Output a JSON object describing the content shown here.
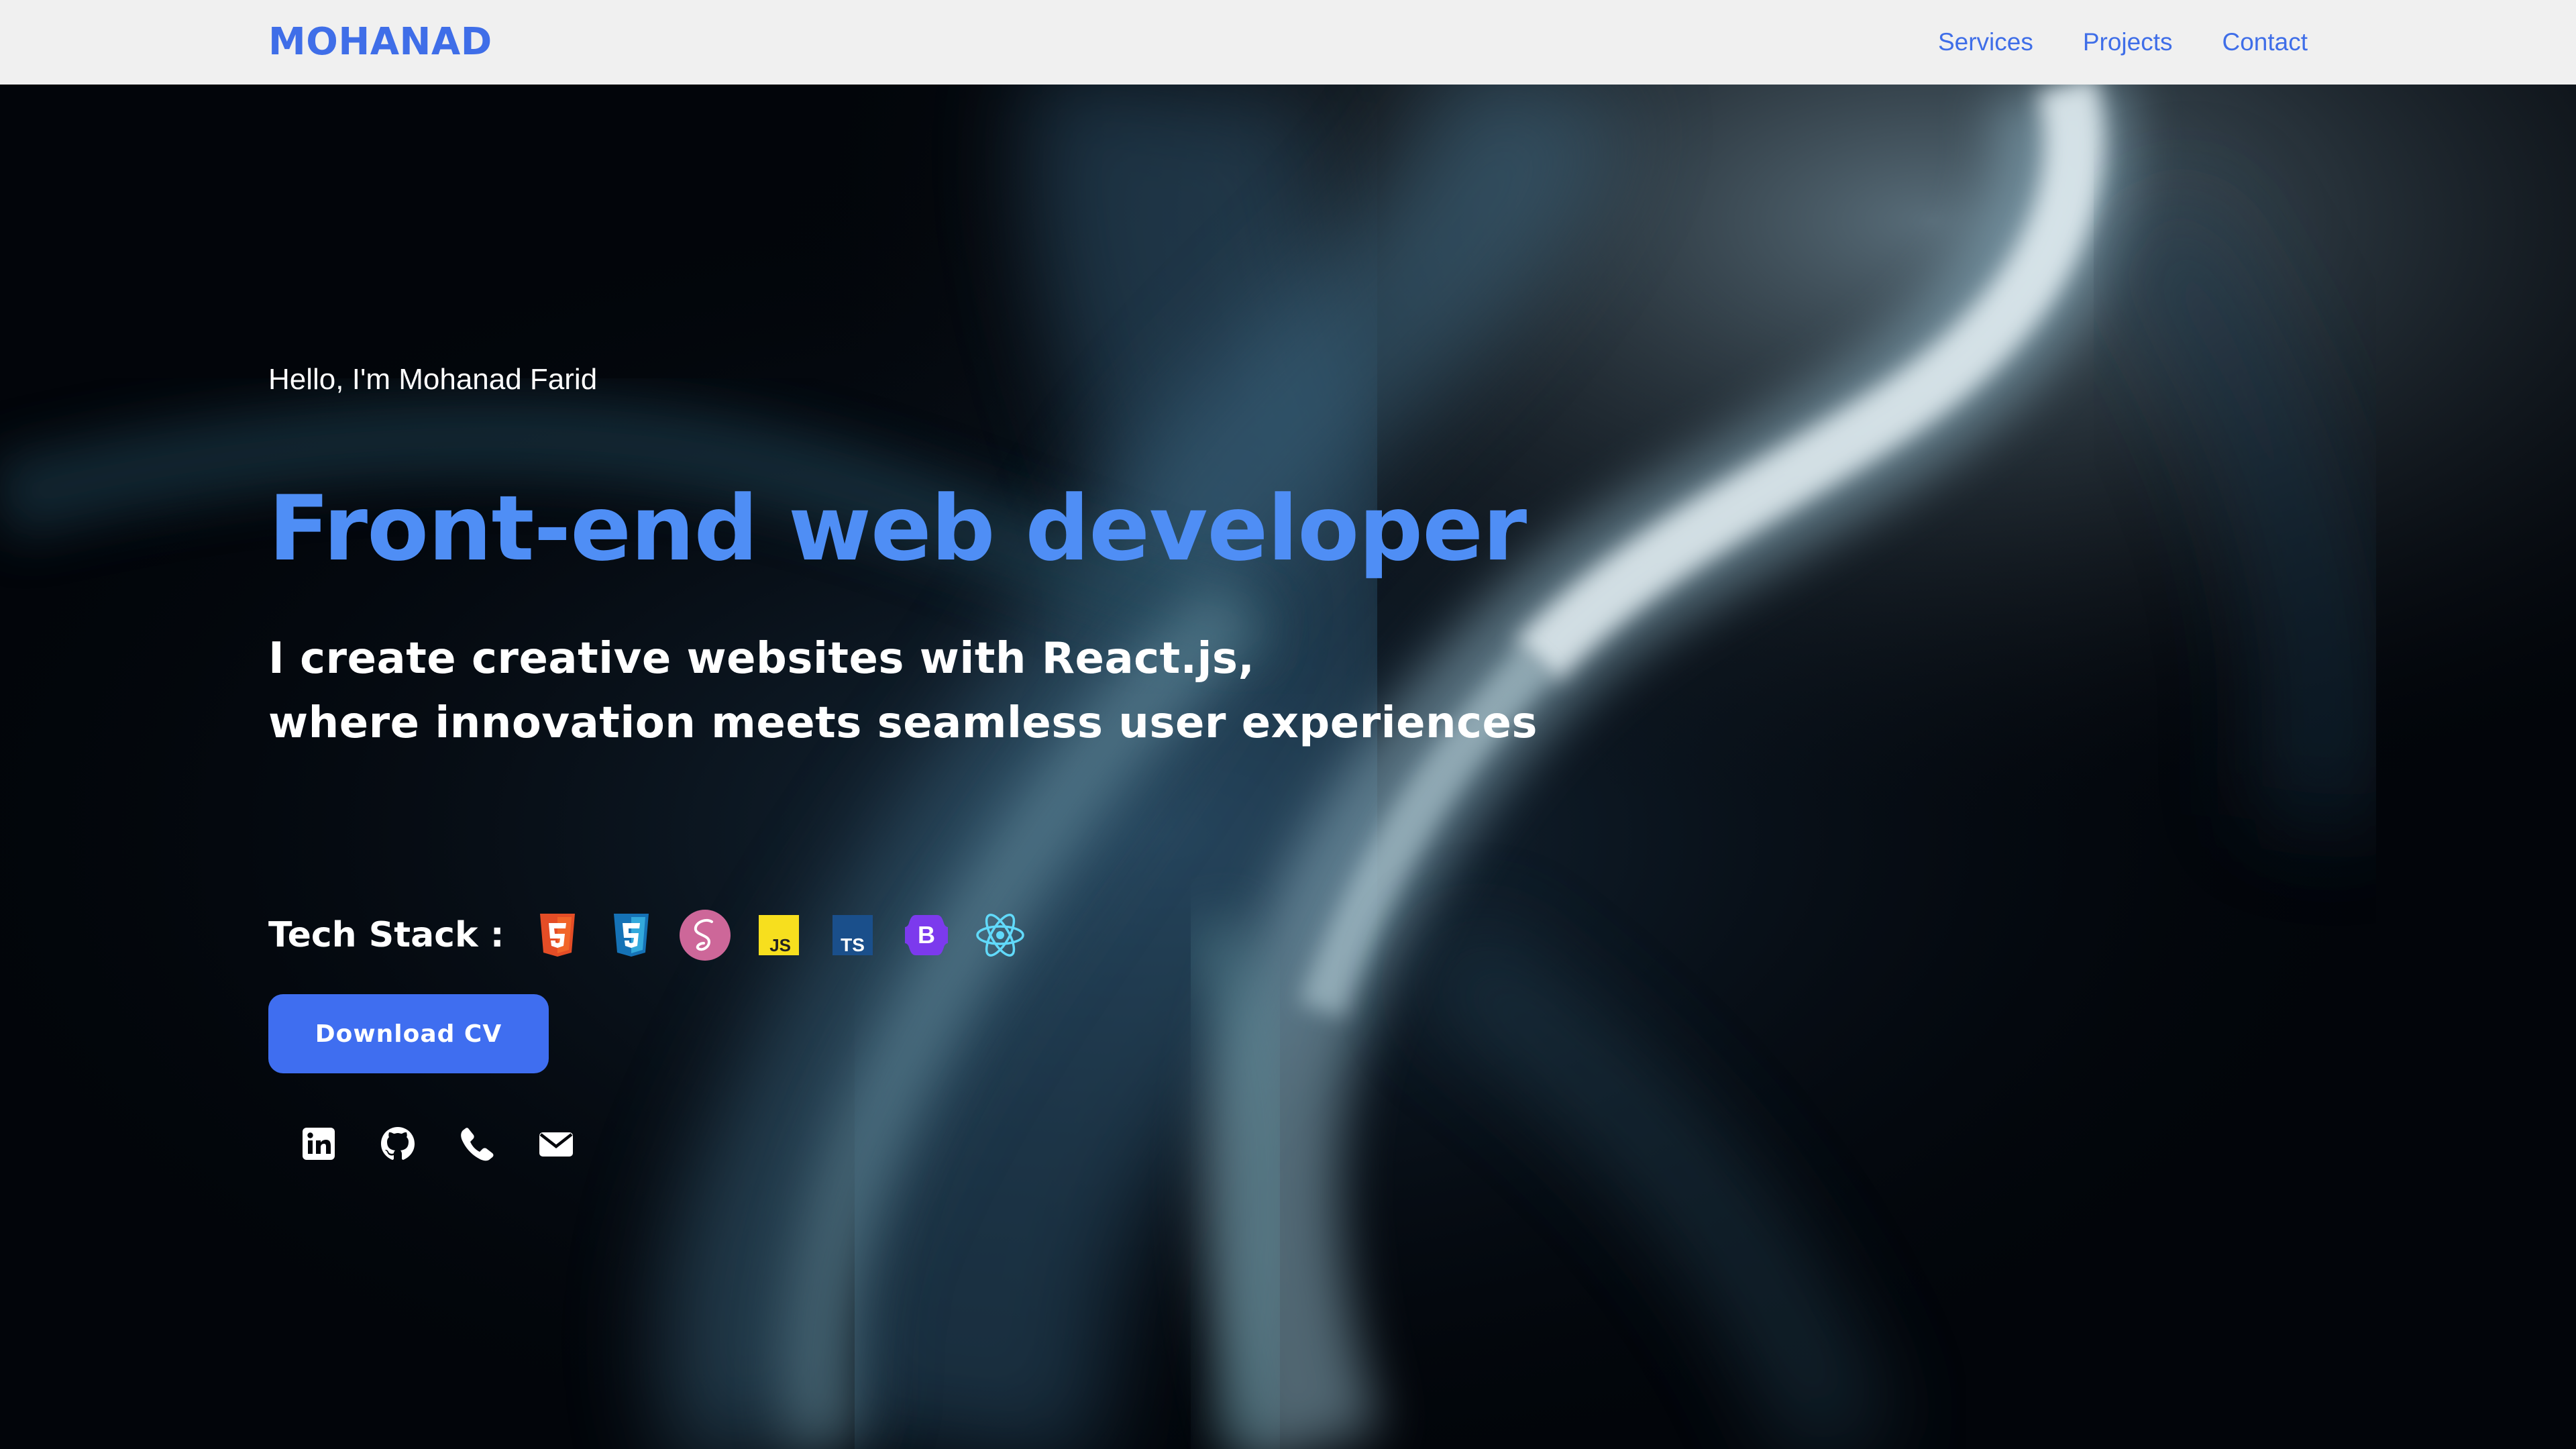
{
  "header": {
    "logo": "MOHANAD",
    "nav": [
      "Services",
      "Projects",
      "Contact"
    ]
  },
  "hero": {
    "greeting": "Hello, I'm Mohanad Farid",
    "headline": "Front-end web developer",
    "tagline": [
      "I create creative websites with React.js,",
      "where innovation meets seamless user experiences"
    ],
    "tech_stack_label": "Tech Stack :",
    "tech_icons": [
      "html5-icon",
      "css3-icon",
      "sass-icon",
      "javascript-icon",
      "typescript-icon",
      "bootstrap-icon",
      "react-icon"
    ],
    "tech_icon_text": {
      "javascript": "JS",
      "typescript": "TS",
      "bootstrap": "B"
    },
    "cv_button": "Download CV",
    "social_icons": [
      "linkedin-icon",
      "github-icon",
      "phone-icon",
      "email-icon"
    ]
  },
  "colors": {
    "accent": "#3f6ee8",
    "headline": "#4f8ef5",
    "header_bg": "#f0f0f0",
    "hero_bg": "#02050a"
  }
}
